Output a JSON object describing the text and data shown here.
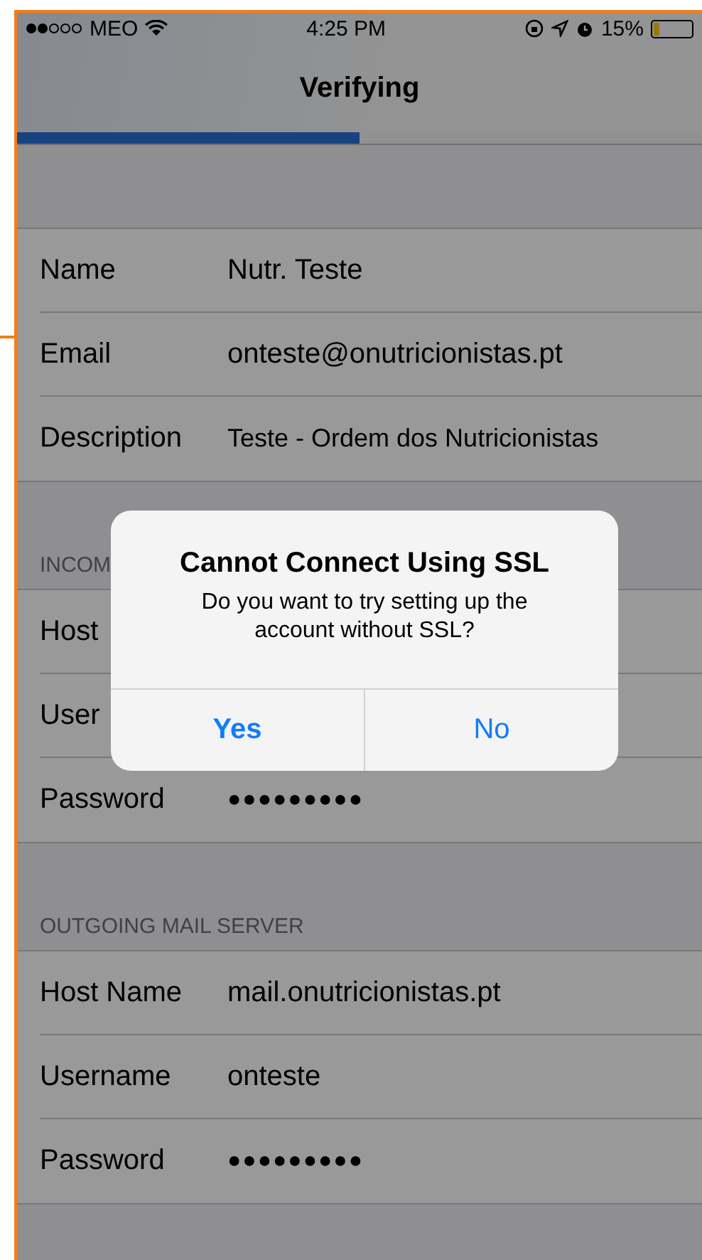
{
  "status_bar": {
    "carrier": "MEO",
    "time": "4:25 PM",
    "battery": "15%"
  },
  "nav": {
    "title": "Verifying"
  },
  "progress": {
    "level": 0.5
  },
  "account": [
    {
      "label": "Name",
      "value": "Nutr. Teste",
      "kind": "text"
    },
    {
      "label": "Email",
      "value": "onteste@onutricionistas.pt",
      "kind": "text"
    },
    {
      "label": "Description",
      "value": "Teste - Ordem dos Nutricionistas",
      "kind": "text"
    }
  ],
  "incoming": {
    "header": "INCOM",
    "rows": [
      {
        "label": "Host",
        "kind": "hidden"
      },
      {
        "label": "User",
        "kind": "hidden"
      },
      {
        "label": "Password",
        "value": "●●●●●●●●●",
        "kind": "secret"
      }
    ]
  },
  "outgoing": {
    "header": "OUTGOING MAIL SERVER",
    "rows": [
      {
        "label": "Host Name",
        "value": "mail.onutricionistas.pt",
        "kind": "text"
      },
      {
        "label": "Username",
        "value": "onteste",
        "kind": "text"
      },
      {
        "label": "Password",
        "value": "●●●●●●●●●",
        "kind": "secret"
      }
    ]
  },
  "alert": {
    "title": "Cannot Connect Using SSL",
    "message": "Do you want to try setting up the account without SSL?",
    "buttons": [
      {
        "label": "Yes",
        "bold": true
      },
      {
        "label": "No",
        "bold": false
      }
    ]
  }
}
